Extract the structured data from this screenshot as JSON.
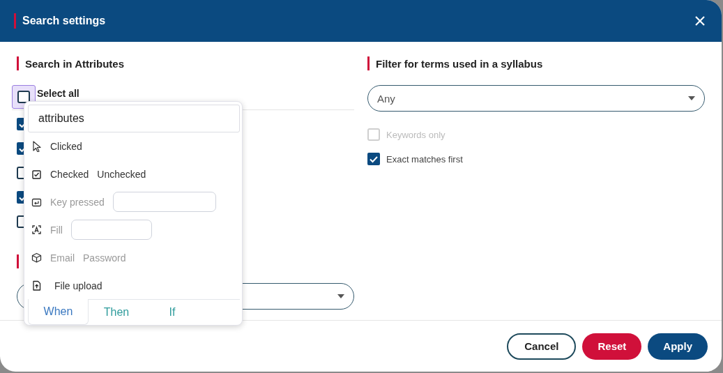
{
  "dialog": {
    "title": "Search settings"
  },
  "left_section": {
    "heading": "Search in Attributes",
    "select_all": {
      "label": "Select all",
      "checked": false
    },
    "attributes": [
      {
        "checked": true
      },
      {
        "checked": true
      },
      {
        "checked": false
      },
      {
        "checked": true
      },
      {
        "checked": false
      }
    ]
  },
  "right_section": {
    "heading": "Filter for terms used in a syllabus",
    "dropdown": {
      "value": "Any"
    },
    "options": [
      {
        "label": "Keywords only",
        "checked": false,
        "disabled": true
      },
      {
        "label": "Exact matches first",
        "checked": true,
        "disabled": false
      }
    ]
  },
  "popup": {
    "search": {
      "value": "attributes"
    },
    "items": [
      {
        "kind": "click",
        "labels": [
          "Clicked"
        ],
        "disabled": false
      },
      {
        "kind": "check",
        "labels": [
          "Checked",
          "Unchecked"
        ],
        "disabled": false
      },
      {
        "kind": "key",
        "labels": [
          "Key pressed"
        ],
        "disabled": true
      },
      {
        "kind": "fill",
        "labels": [
          "Fill"
        ],
        "disabled": true
      },
      {
        "kind": "credentials",
        "labels": [
          "Email",
          "Password"
        ],
        "disabled": true
      },
      {
        "kind": "upload",
        "labels": [
          "File upload"
        ],
        "disabled": false
      }
    ],
    "tabs": [
      {
        "label": "When",
        "selected": true
      },
      {
        "label": "Then",
        "selected": false
      },
      {
        "label": "If",
        "selected": false
      }
    ]
  },
  "buttons": [
    {
      "label": "Cancel",
      "kind": "outline"
    },
    {
      "label": "Reset",
      "kind": "danger"
    },
    {
      "label": "Apply",
      "kind": "primary"
    }
  ]
}
